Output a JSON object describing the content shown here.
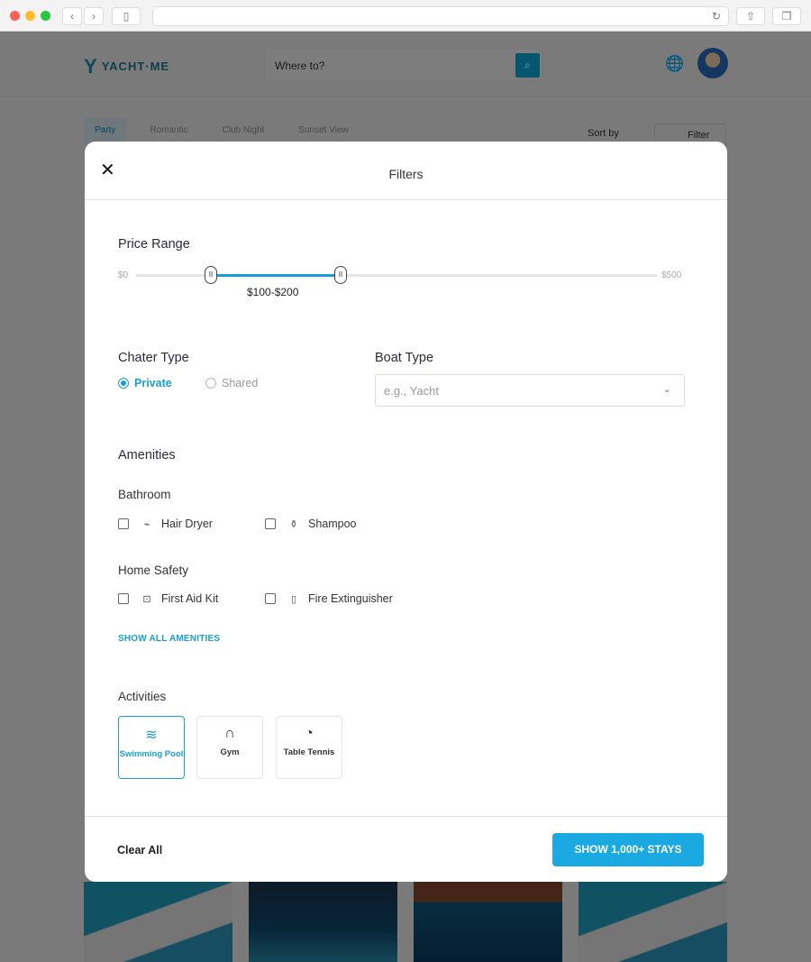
{
  "browser": {
    "url": ""
  },
  "header": {
    "logo": "YACHT·ME",
    "search_placeholder": "Where to?"
  },
  "categories": [
    {
      "label": "Party",
      "active": true
    },
    {
      "label": "Romantic"
    },
    {
      "label": "Club Night"
    },
    {
      "label": "Sunset View"
    }
  ],
  "toolbar": {
    "sort_label": "Sort by",
    "filter_label": "Filter"
  },
  "modal": {
    "title": "Filters",
    "price": {
      "heading": "Price Range",
      "min_label": "$0",
      "max_label": "$500",
      "selected_min": 100,
      "selected_max": 200,
      "range_label": "$100-$200"
    },
    "charter": {
      "heading": "Chater Type",
      "options": [
        {
          "label": "Private",
          "selected": true
        },
        {
          "label": "Shared",
          "selected": false
        }
      ]
    },
    "boat": {
      "heading": "Boat Type",
      "placeholder": "e.g., Yacht"
    },
    "amenities": {
      "heading": "Amenities",
      "groups": [
        {
          "title": "Bathroom",
          "items": [
            {
              "label": "Hair Dryer",
              "icon": "hair-dryer-icon",
              "checked": false
            },
            {
              "label": "Shampoo",
              "icon": "shampoo-icon",
              "checked": false
            }
          ]
        },
        {
          "title": "Home Safety",
          "items": [
            {
              "label": "First Aid Kit",
              "icon": "first-aid-kit-icon",
              "checked": false
            },
            {
              "label": "Fire Extinguisher",
              "icon": "fire-extinguisher-icon",
              "checked": false
            }
          ]
        }
      ],
      "show_all": "SHOW ALL AMENITIES"
    },
    "activities": {
      "heading": "Activities",
      "items": [
        {
          "label": "Swimming Pool",
          "selected": true
        },
        {
          "label": "Gym",
          "selected": false
        },
        {
          "label": "Table Tennis",
          "selected": false
        }
      ]
    },
    "footer": {
      "clear": "Clear All",
      "show": "SHOW 1,000+ STAYS"
    }
  },
  "colors": {
    "accent": "#1ba9e1"
  }
}
